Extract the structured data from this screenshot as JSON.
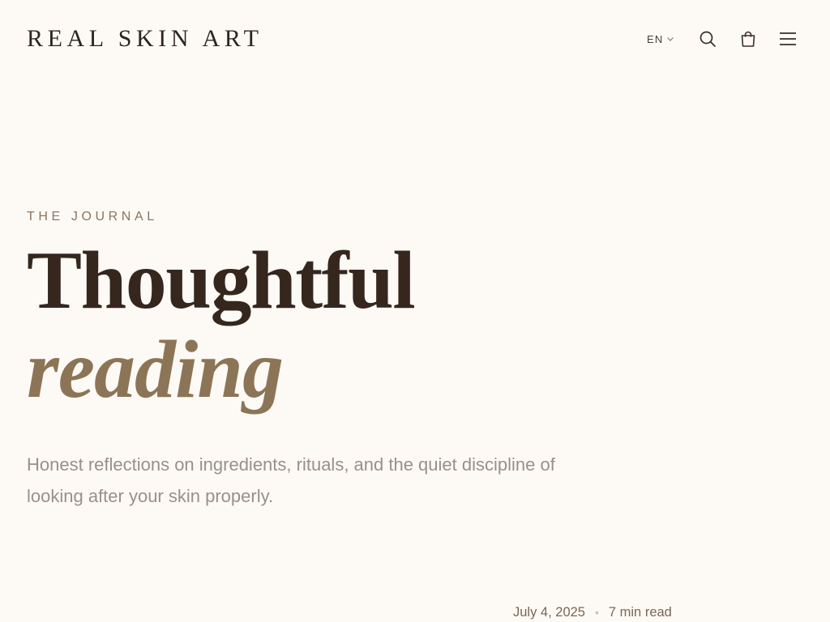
{
  "header": {
    "logo": "REAL SKIN ART",
    "language": "EN",
    "icons": {
      "lang_chevron": "chevron-down-icon",
      "search": "search-icon",
      "cart": "shopping-bag-icon",
      "menu": "menu-icon"
    }
  },
  "hero": {
    "eyebrow": "THE JOURNAL",
    "headline_line1": "Thoughtful",
    "headline_line2": "reading",
    "intro": "Honest reflections on ingredients, rituals, and the quiet discipline of looking after your skin properly."
  },
  "article_meta": {
    "date": "July 4, 2025",
    "separator": "•",
    "read_time": "7 min read"
  },
  "colors": {
    "background": "#fdfaf6",
    "text_dark": "#35271e",
    "accent": "#8c7556",
    "muted": "#9b8f88"
  }
}
